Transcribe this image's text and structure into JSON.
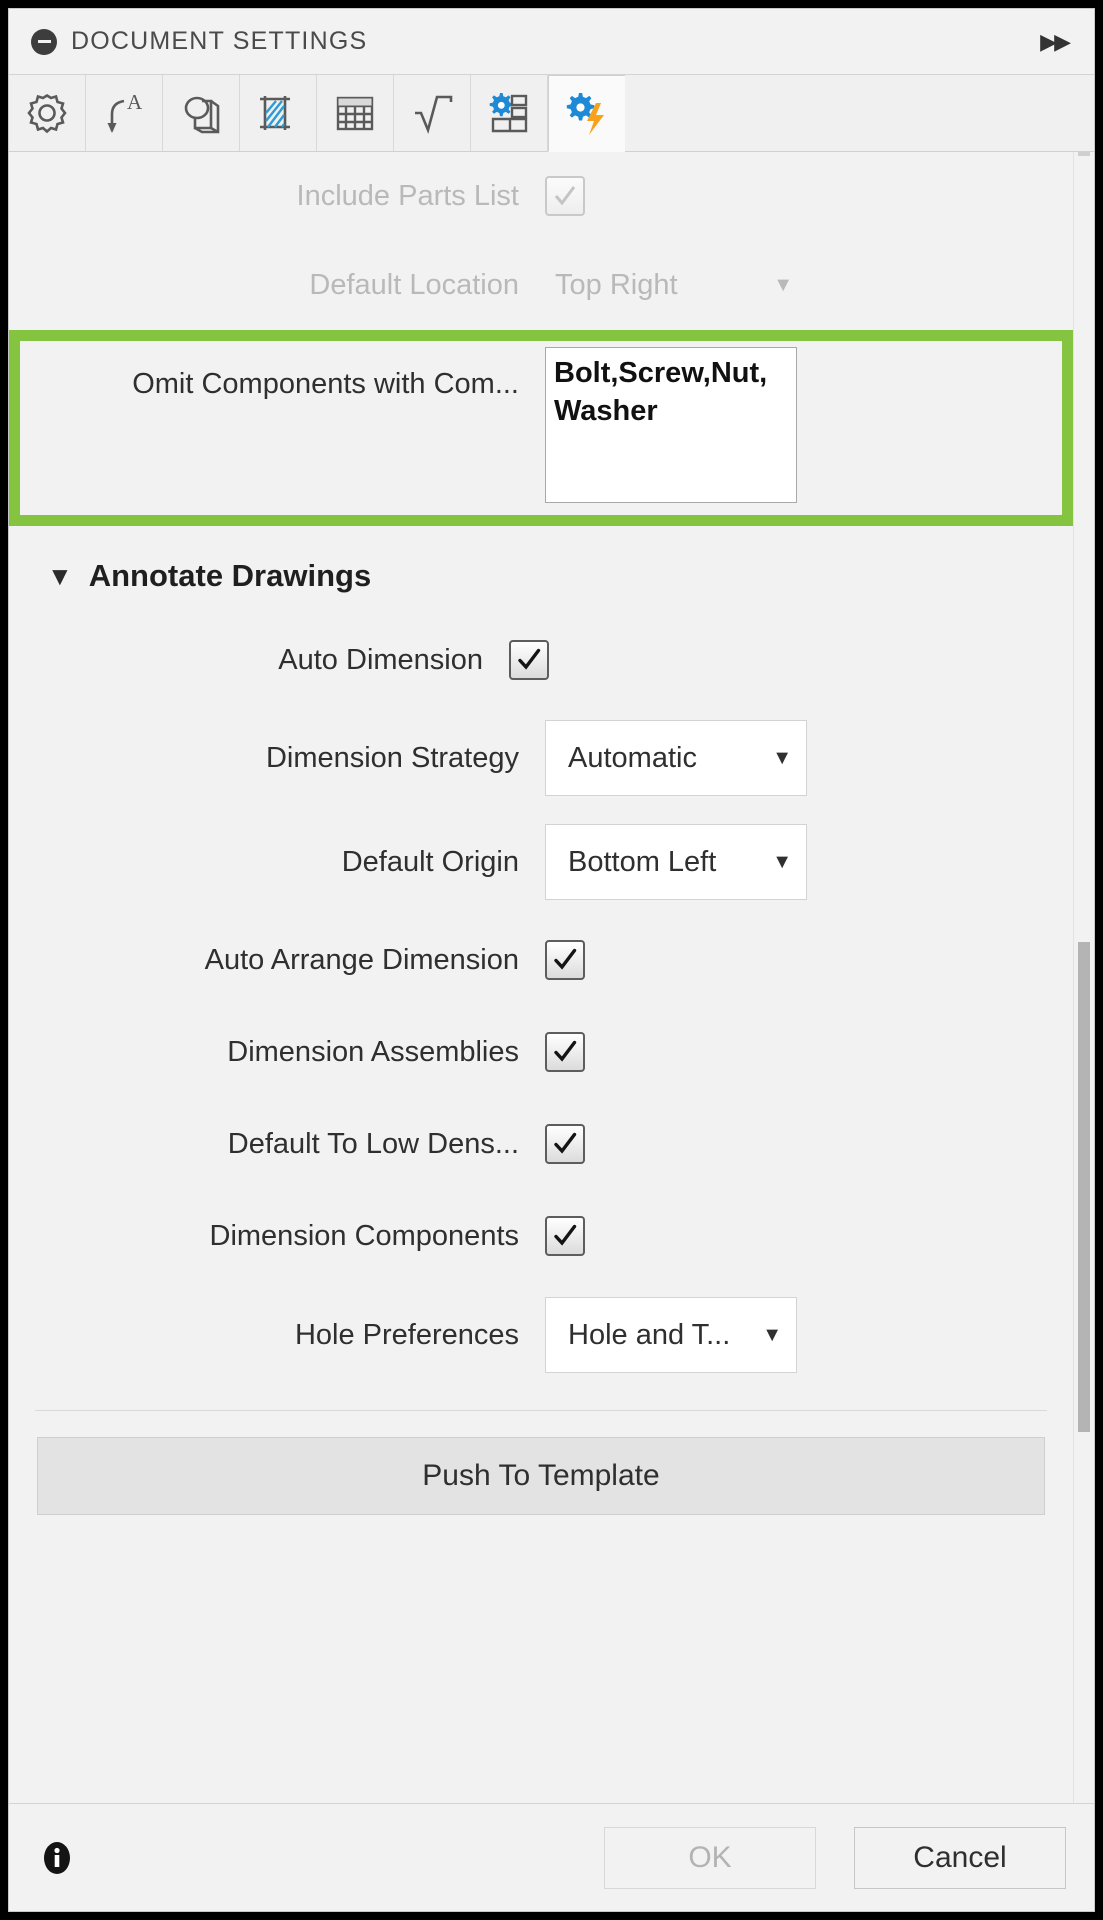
{
  "window": {
    "title": "DOCUMENT SETTINGS",
    "collapse_icon": "minus-circle-icon",
    "expand_icon": "double-chevron-right-icon",
    "expand_glyph": "▶▶"
  },
  "tabs": [
    {
      "name": "general",
      "icon": "gear-icon",
      "active": false
    },
    {
      "name": "annotations",
      "icon": "dimension-arrow-a-icon",
      "active": false
    },
    {
      "name": "views",
      "icon": "shaded-view-icon",
      "active": false
    },
    {
      "name": "section",
      "icon": "hatch-section-icon",
      "active": false
    },
    {
      "name": "tables",
      "icon": "table-grid-icon",
      "active": false
    },
    {
      "name": "math",
      "icon": "square-root-icon",
      "active": false
    },
    {
      "name": "drawing-setup",
      "icon": "gear-layout-icon",
      "active": false
    },
    {
      "name": "automation",
      "icon": "gear-lightning-icon",
      "active": true
    }
  ],
  "rows": {
    "include_parts_list": {
      "label": "Include Parts List",
      "checked": true,
      "disabled": true
    },
    "default_location": {
      "label": "Default Location",
      "value": "Top Right",
      "disabled": true,
      "caret": "▼"
    },
    "omit_components": {
      "label": "Omit Components with Com...",
      "value": "Bolt,Screw,Nut,Washer",
      "highlighted": true,
      "highlight_color": "#85c440"
    }
  },
  "annotate_section": {
    "title": "Annotate Drawings",
    "expanded": true,
    "triangle": "▼",
    "items": [
      {
        "name": "auto-dimension",
        "label": "Auto Dimension",
        "type": "checkbox",
        "checked": true,
        "indent": 0
      },
      {
        "name": "dimension-strategy",
        "label": "Dimension Strategy",
        "type": "dropdown",
        "value": "Automatic",
        "indent": 1
      },
      {
        "name": "default-origin",
        "label": "Default Origin",
        "type": "dropdown",
        "value": "Bottom Left",
        "indent": 1
      },
      {
        "name": "auto-arrange-dimension",
        "label": "Auto Arrange Dimension",
        "type": "checkbox",
        "checked": true,
        "indent": 1
      },
      {
        "name": "dimension-assemblies",
        "label": "Dimension Assemblies",
        "type": "checkbox",
        "checked": true,
        "indent": 1
      },
      {
        "name": "default-to-low-density",
        "label": "Default To Low Dens...",
        "type": "checkbox",
        "checked": true,
        "indent": 2
      },
      {
        "name": "dimension-components",
        "label": "Dimension Components",
        "type": "checkbox",
        "checked": true,
        "indent": 1
      },
      {
        "name": "hole-preferences",
        "label": "Hole Preferences",
        "type": "dropdown",
        "value": "Hole and T...",
        "indent": 1
      }
    ]
  },
  "push_to_template": {
    "label": "Push To Template"
  },
  "footer": {
    "info_icon": "info-icon",
    "ok": {
      "label": "OK",
      "disabled": true
    },
    "cancel": {
      "label": "Cancel",
      "disabled": false
    }
  },
  "caret_glyph": "▼"
}
